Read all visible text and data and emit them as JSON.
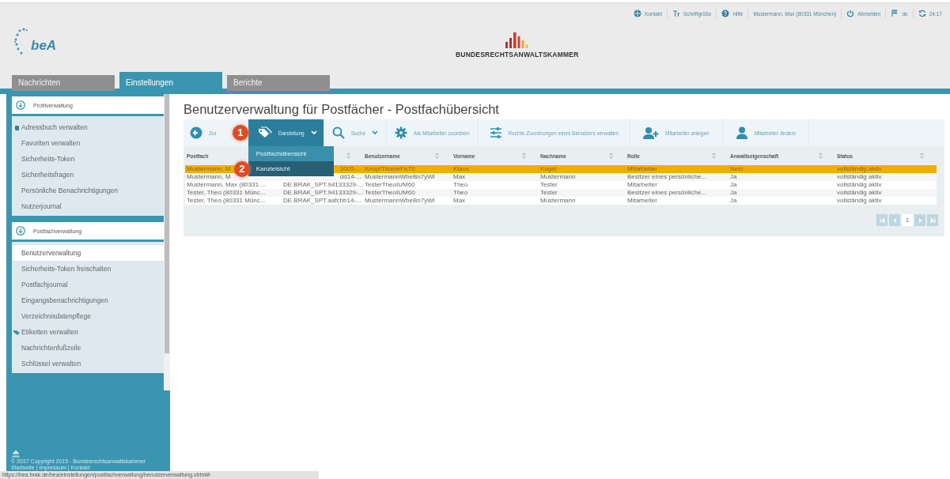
{
  "top_links": [
    {
      "kind": "contact",
      "label": "Kontakt"
    },
    {
      "kind": "font",
      "label": "Schriftgröße"
    },
    {
      "kind": "help",
      "label": "Hilfe"
    },
    {
      "kind": "user",
      "label": "Mustermann, Max (80331 München)"
    },
    {
      "kind": "logout",
      "label": "Abmelden"
    },
    {
      "kind": "language",
      "label": "de"
    },
    {
      "kind": "timer",
      "label": "24:17"
    }
  ],
  "logo": {
    "text": "beA"
  },
  "org_logo": {
    "text": "BUNDESRECHTSANWALTSKAMMER"
  },
  "tabs": [
    {
      "label": "Nachrichten",
      "selected": false
    },
    {
      "label": "Einstellungen",
      "selected": true
    },
    {
      "label": "Berichte",
      "selected": false
    }
  ],
  "sidebar": {
    "sections": [
      {
        "title": "Profilverwaltung",
        "items": [
          {
            "label": "Adressbuch verwalten",
            "kind": "book",
            "selected": false
          },
          {
            "label": "Favoriten verwalten",
            "kind": "plain",
            "selected": false
          },
          {
            "label": "Sicherheits-Token",
            "kind": "plain",
            "selected": false
          },
          {
            "label": "Sicherheitsfragen",
            "kind": "plain",
            "selected": false
          },
          {
            "label": "Persönliche Benachrichtigungen",
            "kind": "plain",
            "selected": false
          },
          {
            "label": "Nutzerjournal",
            "kind": "plain",
            "selected": false
          }
        ]
      },
      {
        "title": "Postfachverwaltung",
        "items": [
          {
            "label": "Benutzerverwaltung",
            "kind": "plain",
            "selected": true
          },
          {
            "label": "Sicherheits-Token freischalten",
            "kind": "plain",
            "selected": false
          },
          {
            "label": "Postfachjournal",
            "kind": "plain",
            "selected": false
          },
          {
            "label": "Eingangsbenachrichtigungen",
            "kind": "plain",
            "selected": false
          },
          {
            "label": "Verzeichnisdatenpflege",
            "kind": "plain",
            "selected": false
          },
          {
            "label": "Etiketten verwalten",
            "kind": "tag",
            "selected": false
          },
          {
            "label": "Nachrichtenfußzeile",
            "kind": "plain",
            "selected": false
          },
          {
            "label": "Schlüssel verwalten",
            "kind": "plain",
            "selected": false
          }
        ]
      }
    ],
    "footer": [
      "© 2017 Copyright 2015 - Bundesrechtsanwaltskammer",
      "Startseite | Impressum | Kontakt"
    ]
  },
  "page_title": "Benutzerverwaltung für Postfächer - Postfachübersicht",
  "toolbar": [
    {
      "kind": "back",
      "label": "Zur"
    },
    {
      "kind": "view",
      "label": "Darstellung",
      "menu": [
        {
          "label": "Postfachübersicht",
          "selected": false
        },
        {
          "label": "Kanzleisicht",
          "selected": true
        }
      ]
    },
    {
      "kind": "search",
      "label": "Suche"
    },
    {
      "kind": "assign",
      "label": "Als Mitarbeiter zuordnen"
    },
    {
      "kind": "rights",
      "label": "Rechte-Zuordnungen eines Benutzers verwalten"
    },
    {
      "kind": "add-user",
      "label": "Mitarbeiter anlegen"
    },
    {
      "kind": "edit-user",
      "label": "Mitarbeiter ändern"
    }
  ],
  "callouts": [
    "1",
    "2"
  ],
  "table": {
    "columns": [
      {
        "label": "Postfach"
      },
      {
        "sortable": true
      },
      {
        "label": "Benutzername",
        "sortable": true
      },
      {
        "label": "Vorname",
        "sortable": true
      },
      {
        "label": "Nachname",
        "sortable": true
      },
      {
        "label": "Rolle",
        "sortable": true
      },
      {
        "label": "Anwaltseigenschaft",
        "sortable": true
      },
      {
        "label": "Status",
        "sortable": true
      }
    ],
    "rows": [
      {
        "selected": true,
        "cells": [
          "Mustermann, M",
          "3005-...",
          "KnopfTimmeFeT0",
          "Klaus",
          "Kugel",
          "Mitarbeiter",
          "Nein",
          "vollständig aktiv"
        ]
      },
      {
        "selected": false,
        "cells": [
          "Mustermann, M",
          "dd14-...",
          "MustermannWbeBn7yWl",
          "Max",
          "Mustermann",
          "Besitzer eines persönliche...",
          "Ja",
          "vollständig aktiv"
        ]
      },
      {
        "selected": false,
        "cells": [
          "Mustermann, Max (80331 ...",
          "DE.BRAK_SPT.94133329-...",
          "TesterTheoIUM60",
          "Theo",
          "Tester",
          "Mitarbeiter",
          "Ja",
          "vollständig aktiv"
        ]
      },
      {
        "selected": false,
        "cells": [
          "Tester, Theo (80331 Münc...",
          "DE.BRAK_SPT.94133329-...",
          "TesterTheoIUM60",
          "Theo",
          "Tester",
          "Besitzer eines persönliche...",
          "Ja",
          "vollständig aktiv"
        ]
      },
      {
        "selected": false,
        "cells": [
          "Tester, Theo (80331 Münc...",
          "DE.BRAK_SPT.aafcbb14-...",
          "MustermannWbeBn7yWl",
          "Max",
          "Mustermann",
          "Mitarbeiter",
          "Ja",
          "vollständig aktiv"
        ]
      }
    ],
    "pager": [
      {
        "kind": "first",
        "selected": false
      },
      {
        "kind": "prev",
        "selected": false
      },
      {
        "kind": "page",
        "label": "1",
        "selected": true
      },
      {
        "kind": "next",
        "selected": false
      },
      {
        "kind": "last",
        "selected": false
      }
    ]
  },
  "status_bar": "https://bea.brak.de/bea/einstellungen/postfachverwaltung/benutzerverwaltung.xhtml#"
}
